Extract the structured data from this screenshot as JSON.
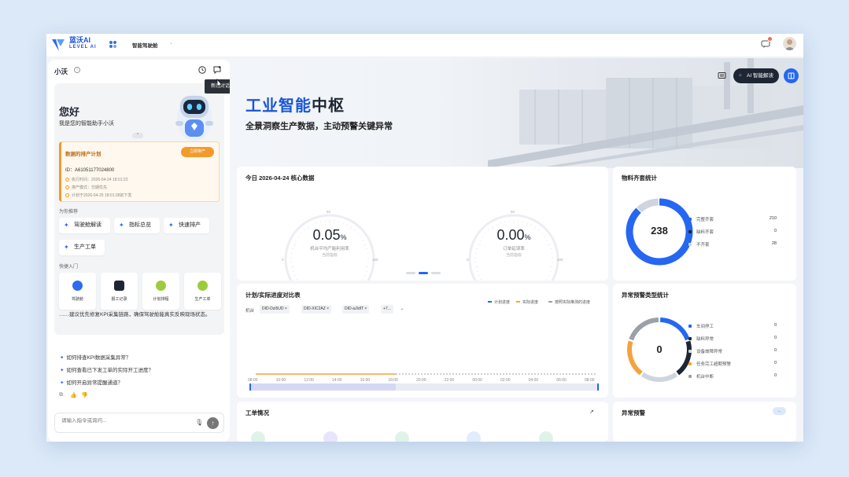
{
  "app": {
    "logo_name": "蓝沃AI",
    "logo_sub": "LEVEL AI",
    "nav_title": "智能驾驶舱",
    "nav_chevron": "⌄"
  },
  "assistant": {
    "name": "小沃",
    "info_glyph": "i",
    "tooltip": "新建对话",
    "greeting": "您好",
    "greeting_sub": "我是您的智能助手小沃",
    "collapse_glyph": "^",
    "card": {
      "title": "数据的排产计划",
      "button": "立即排产",
      "id": "ID：A61051177024800",
      "lines": [
        "执行时间：2026-04-24 18:01:23",
        "排产模式：交期优先",
        "计划于2026-04-25 18:01:28前下发"
      ]
    },
    "recommend_label": "为你推荐",
    "chips": [
      "驾驶舱解读",
      "指标总览",
      "快速排产",
      "生产工单"
    ],
    "quick_label": "快捷入门",
    "quick_entries": [
      "驾驶舱",
      "报工记录",
      "计划排程",
      "生产工单"
    ],
    "bubble_text": "……建议优先修复KPI采集链路，确保驾驶舱能真实反映现场状态。",
    "questions": [
      "如何排查KPI数据采集异常？",
      "如何查看已下发工单的实际开工进度？",
      "如何开启异常提醒通道？"
    ],
    "feedback": [
      "⧉",
      "👍",
      "👎"
    ],
    "input_placeholder": "请输入指令或询问...",
    "mic_glyph": "🎙",
    "send_glyph": "↑"
  },
  "hero": {
    "title_highlight": "工业智能",
    "title_rest": "中枢",
    "subtitle": "全景洞察生产数据，主动预警关键异常",
    "ai_button": "AI 智能解读",
    "ai_glyph": "✧"
  },
  "core": {
    "title": "今日 2026-04-24 核心数据",
    "gauges": [
      {
        "value": "0.05",
        "unit": "%",
        "label": "机台平均产能利用率",
        "sub": "当前指标",
        "min": "0",
        "mid": "50",
        "max": "100",
        "ratio": 0.0005
      },
      {
        "value": "0.00",
        "unit": "%",
        "label": "订单延误率",
        "sub": "当前指标",
        "min": "0",
        "mid": "50",
        "max": "100",
        "ratio": 0
      }
    ]
  },
  "material": {
    "title": "物料齐套统计",
    "total": "238",
    "items": [
      {
        "label": "完整齐套",
        "value": "210",
        "color": "#2567f0"
      },
      {
        "label": "缺料齐套",
        "value": "0",
        "color": "#1f2633"
      },
      {
        "label": "不齐套",
        "value": "28",
        "color": "#cfd5de"
      }
    ]
  },
  "progress": {
    "title": "计划/实际进度对比表",
    "machine_label": "机台",
    "tags": [
      "DID-Dzi5UD ×",
      "DID-XIC2AZ ×",
      "DID-aJIdlT ×",
      "+7..."
    ],
    "legend": [
      "计划进度",
      "实际进度",
      "按照实际推测的进度"
    ],
    "xticks": [
      "08:00",
      "10:00",
      "12:00",
      "14:00",
      "16:00",
      "18:00",
      "20:00",
      "22:00",
      "00:00",
      "02:00",
      "04:00",
      "06:00",
      "08:00"
    ]
  },
  "abnormal": {
    "title": "异常预警类型统计",
    "total": "0",
    "items": [
      {
        "label": "车间停工",
        "value": "0",
        "color": "#2567f0"
      },
      {
        "label": "缺料异常",
        "value": "0",
        "color": "#1f2633"
      },
      {
        "label": "设备故障异常",
        "value": "0",
        "color": "#cfd5de"
      },
      {
        "label": "任务完工超期预警",
        "value": "0",
        "color": "#f5a23c"
      },
      {
        "label": "机台中断",
        "value": "0",
        "color": "#9aa1ab"
      }
    ]
  },
  "workorders": {
    "title": "工单情况",
    "expand_glyph": "↗"
  },
  "alerts": {
    "title": "异常预警",
    "more_glyph": "..."
  }
}
